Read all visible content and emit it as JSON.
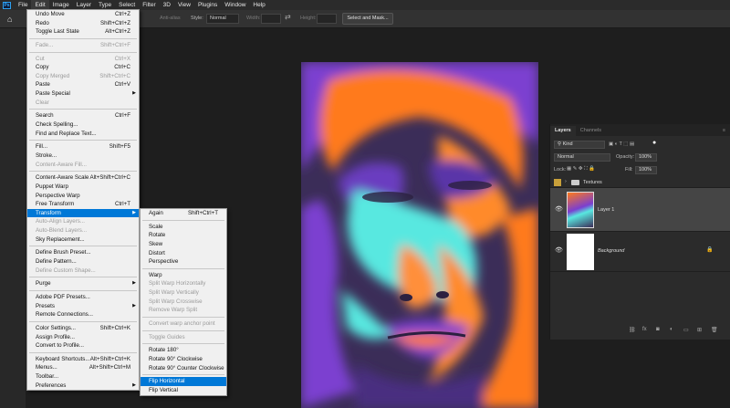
{
  "app": {
    "logo": "Ps"
  },
  "menubar": [
    "File",
    "Edit",
    "Image",
    "Layer",
    "Type",
    "Select",
    "Filter",
    "3D",
    "View",
    "Plugins",
    "Window",
    "Help"
  ],
  "options_bar": {
    "antialias_label": "Anti-alias",
    "style_label": "Style:",
    "style_value": "Normal",
    "width_label": "Width:",
    "height_label": "Height:",
    "select_mask_button": "Select and Mask..."
  },
  "edit_menu": [
    {
      "label": "Undo Move",
      "shortcut": "Ctrl+Z"
    },
    {
      "label": "Redo",
      "shortcut": "Shift+Ctrl+Z"
    },
    {
      "label": "Toggle Last State",
      "shortcut": "Alt+Ctrl+Z"
    },
    {
      "sep": true
    },
    {
      "label": "Fade...",
      "shortcut": "Shift+Ctrl+F",
      "disabled": true
    },
    {
      "sep": true
    },
    {
      "label": "Cut",
      "shortcut": "Ctrl+X",
      "disabled": true
    },
    {
      "label": "Copy",
      "shortcut": "Ctrl+C"
    },
    {
      "label": "Copy Merged",
      "shortcut": "Shift+Ctrl+C",
      "disabled": true
    },
    {
      "label": "Paste",
      "shortcut": "Ctrl+V"
    },
    {
      "label": "Paste Special",
      "submenu": true
    },
    {
      "label": "Clear",
      "disabled": true
    },
    {
      "sep": true
    },
    {
      "label": "Search",
      "shortcut": "Ctrl+F"
    },
    {
      "label": "Check Spelling..."
    },
    {
      "label": "Find and Replace Text..."
    },
    {
      "sep": true
    },
    {
      "label": "Fill...",
      "shortcut": "Shift+F5"
    },
    {
      "label": "Stroke..."
    },
    {
      "label": "Content-Aware Fill...",
      "disabled": true
    },
    {
      "sep": true
    },
    {
      "label": "Content-Aware Scale",
      "shortcut": "Alt+Shift+Ctrl+C"
    },
    {
      "label": "Puppet Warp"
    },
    {
      "label": "Perspective Warp"
    },
    {
      "label": "Free Transform",
      "shortcut": "Ctrl+T"
    },
    {
      "label": "Transform",
      "submenu": true,
      "highlighted": true
    },
    {
      "label": "Auto-Align Layers...",
      "disabled": true
    },
    {
      "label": "Auto-Blend Layers...",
      "disabled": true
    },
    {
      "label": "Sky Replacement..."
    },
    {
      "sep": true
    },
    {
      "label": "Define Brush Preset..."
    },
    {
      "label": "Define Pattern..."
    },
    {
      "label": "Define Custom Shape...",
      "disabled": true
    },
    {
      "sep": true
    },
    {
      "label": "Purge",
      "submenu": true
    },
    {
      "sep": true
    },
    {
      "label": "Adobe PDF Presets..."
    },
    {
      "label": "Presets",
      "submenu": true
    },
    {
      "label": "Remote Connections..."
    },
    {
      "sep": true
    },
    {
      "label": "Color Settings...",
      "shortcut": "Shift+Ctrl+K"
    },
    {
      "label": "Assign Profile..."
    },
    {
      "label": "Convert to Profile..."
    },
    {
      "sep": true
    },
    {
      "label": "Keyboard Shortcuts...",
      "shortcut": "Alt+Shift+Ctrl+K"
    },
    {
      "label": "Menus...",
      "shortcut": "Alt+Shift+Ctrl+M"
    },
    {
      "label": "Toolbar..."
    },
    {
      "label": "Preferences",
      "submenu": true
    }
  ],
  "transform_menu": [
    {
      "label": "Again",
      "shortcut": "Shift+Ctrl+T"
    },
    {
      "sep": true
    },
    {
      "label": "Scale"
    },
    {
      "label": "Rotate"
    },
    {
      "label": "Skew"
    },
    {
      "label": "Distort"
    },
    {
      "label": "Perspective"
    },
    {
      "sep": true
    },
    {
      "label": "Warp"
    },
    {
      "label": "Split Warp Horizontally",
      "disabled": true
    },
    {
      "label": "Split Warp Vertically",
      "disabled": true
    },
    {
      "label": "Split Warp Crosswise",
      "disabled": true
    },
    {
      "label": "Remove Warp Split",
      "disabled": true
    },
    {
      "sep": true
    },
    {
      "label": "Convert warp anchor point",
      "disabled": true
    },
    {
      "sep": true
    },
    {
      "label": "Toggle Guides",
      "disabled": true
    },
    {
      "sep": true
    },
    {
      "label": "Rotate 180°"
    },
    {
      "label": "Rotate 90° Clockwise"
    },
    {
      "label": "Rotate 90° Counter Clockwise"
    },
    {
      "sep": true
    },
    {
      "label": "Flip Horizontal",
      "highlighted": true
    },
    {
      "label": "Flip Vertical"
    }
  ],
  "layers_panel": {
    "tabs": [
      "Layers",
      "Channels"
    ],
    "kind_label": "Kind",
    "blend_mode": "Normal",
    "opacity_label": "Opacity:",
    "opacity_value": "100%",
    "lock_label": "Lock:",
    "fill_label": "Fill:",
    "fill_value": "100%",
    "layers": [
      {
        "name": "Textures",
        "type": "group"
      },
      {
        "name": "Layer 1",
        "type": "image",
        "selected": true
      },
      {
        "name": "Background",
        "type": "background",
        "locked": true
      }
    ],
    "footer_icons": [
      "link-icon",
      "fx-icon",
      "mask-icon",
      "adjustment-icon",
      "group-icon",
      "new-layer-icon",
      "trash-icon"
    ]
  },
  "colors": {
    "menu_bg": "#f0f0f0",
    "highlight": "#0078d7",
    "canvas_orange": "#ff7a1a",
    "canvas_purple": "#7b3fd0",
    "canvas_cyan": "#58e8e0"
  }
}
